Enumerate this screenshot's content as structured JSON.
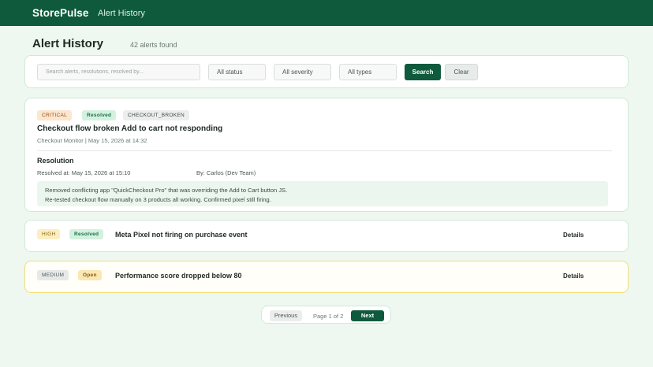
{
  "header": {
    "brand": "StorePulse",
    "nav_link": "Alert History"
  },
  "page": {
    "title": "Alert History",
    "count_text": "42 alerts found"
  },
  "filters": {
    "search_placeholder": "Search alerts, resolutions, resolved by...",
    "status": "All status",
    "severity": "All severity",
    "types": "All types",
    "search_button": "Search",
    "clear_button": "Clear"
  },
  "alerts": [
    {
      "severity": "CRITICAL",
      "status": "Resolved",
      "type": "CHECKOUT_BROKEN",
      "title": "Checkout flow broken Add to cart not responding",
      "meta": "Checkout Monitor | May 15, 2026 at 14:32",
      "resolution": {
        "heading": "Resolution",
        "resolved_at": "Resolved at: May 15, 2026 at 15:10",
        "resolved_by": "By: Carlos (Dev Team)",
        "notes": [
          "Removed conflicting app \"QuickCheckout Pro\" that was overriding the Add to Cart button JS.",
          "Re-tested checkout flow manually on 3 products all working. Confirmed pixel still firing."
        ]
      }
    },
    {
      "severity": "HIGH",
      "status": "Resolved",
      "title": "Meta Pixel not firing on purchase event",
      "details_label": "Details"
    },
    {
      "severity": "MEDIUM",
      "status": "Open",
      "title": "Performance score dropped below 80",
      "details_label": "Details"
    }
  ],
  "pagination": {
    "previous": "Previous",
    "page_info": "Page 1 of 2",
    "next": "Next"
  },
  "colors": {
    "primary": "#0f5a3d",
    "background": "#eef8f0",
    "card_border": "#cfe9d8",
    "open_alert_border": "#f2dc7a"
  }
}
